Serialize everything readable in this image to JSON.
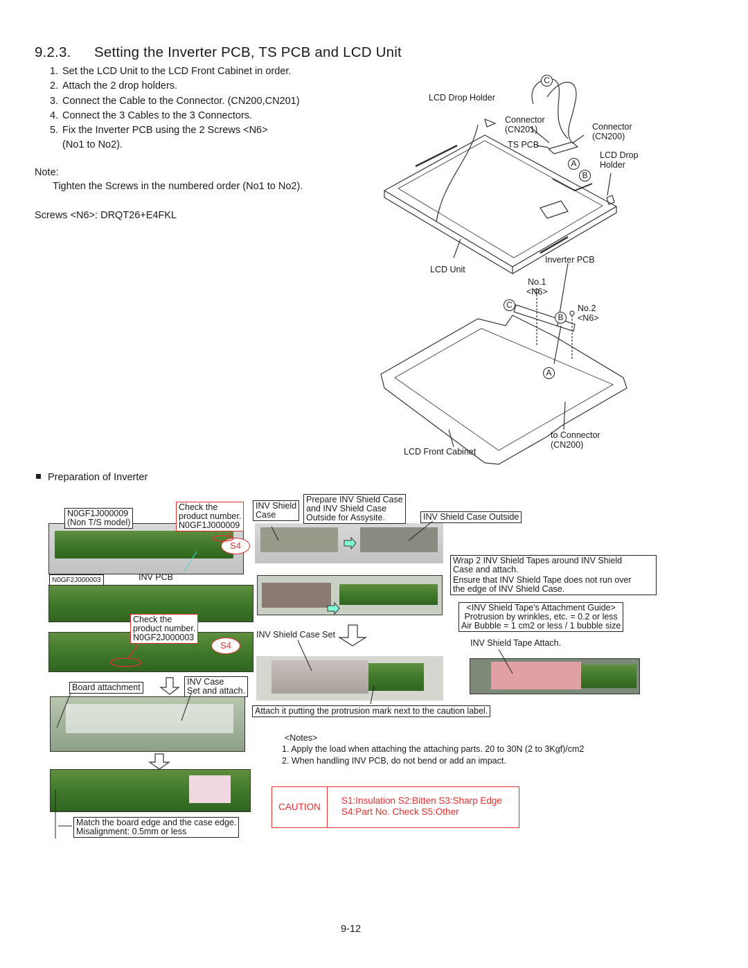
{
  "section": {
    "number": "9.2.3.",
    "title": "Setting the Inverter PCB, TS PCB and LCD Unit"
  },
  "steps": [
    {
      "num": "1.",
      "text": "Set the LCD Unit to the LCD Front Cabinet in order."
    },
    {
      "num": "2.",
      "text": "Attach the 2 drop holders."
    },
    {
      "num": "3.",
      "text": "Connect the Cable to the Connector. (CN200,CN201)"
    },
    {
      "num": "4.",
      "text": "Connect the 3 Cables to the 3 Connectors."
    },
    {
      "num": "5.",
      "text": "Fix the Inverter PCB using the 2 Screws <N6>",
      "cont": "(No1 to No2)."
    }
  ],
  "note": {
    "heading": "Note:",
    "text": "Tighten the Screws in the numbered order (No1 to No2)."
  },
  "screws": "Screws <N6>: DRQT26+E4FKL",
  "diagram_top": {
    "lcd_drop_holder_left": "LCD Drop Holder",
    "connector_cn201": [
      "Connector",
      "(CN201)"
    ],
    "connector_cn200": [
      "Connector",
      "(CN200)"
    ],
    "ts_pcb": "TS PCB",
    "lcd_drop_holder_right": [
      "LCD Drop",
      "Holder"
    ],
    "inverter_pcb": "Inverter PCB",
    "lcd_unit": "LCD Unit",
    "marker_a": "A",
    "marker_b": "B",
    "marker_c": "C"
  },
  "diagram_bottom": {
    "no1": [
      "No.1",
      "<N6>"
    ],
    "no2": [
      "No.2",
      "<N6>"
    ],
    "to_connector": [
      "to Connector",
      "(CN200)"
    ],
    "lcd_front_cabinet": "LCD Front Cabinet",
    "marker_a": "A",
    "marker_b": "B",
    "marker_c": "C"
  },
  "preparation": {
    "heading": "Preparation of Inverter",
    "n0gf1": [
      "N0GF1J000009",
      "(Non T/S model)"
    ],
    "check1": [
      "Check the",
      "product number.",
      "N0GF1J000009"
    ],
    "s4": "S4",
    "n0gf2": "N0GF2J000003",
    "inv_pcb": "INV PCB",
    "check2": [
      "Check the",
      "product number.",
      "N0GF2J000003"
    ],
    "board_attachment": "Board attachment",
    "inv_case": [
      "INV Case",
      "Set and attach."
    ],
    "match": [
      "Match the board edge and the case edge.",
      "Misalignment: 0.5mm or less"
    ],
    "inv_shield_case": [
      "INV Shield",
      "Case"
    ],
    "prepare": [
      "Prepare INV Shield Case",
      "and INV Shield Case",
      "Outside for Assysite."
    ],
    "inv_shield_case_outside": "INV Shield Case Outside",
    "wrap": [
      "Wrap 2 INV Shield Tapes around INV Shield",
      "Case and attach.",
      "Ensure that INV Shield Tape does not run over",
      "the edge of INV Shield Case."
    ],
    "guide": [
      "<INV Shield Tape's Attachment Guide>",
      "Protrusion by wrinkles, etc. = 0.2 or less",
      "Air Bubble = 1 cm2 or less / 1 bubble size"
    ],
    "tape_attach": "INV Shield Tape Attach.",
    "case_set": "INV Shield Case Set",
    "attach_mark": "Attach it putting the protrusion mark next to the caution label."
  },
  "notes": {
    "heading": "<Notes>",
    "items": [
      "1. Apply the load when attaching the attaching parts. 20 to 30N (2 to 3Kgf)/cm2",
      "2. When handling INV PCB, do not bend or add an impact."
    ]
  },
  "caution": {
    "label": "CAUTION",
    "line1": "S1:Insulation  S2:Bitten  S3:Sharp Edge",
    "line2": "S4:Part No. Check  S5:Other",
    "color": "#e03030"
  },
  "page_number": "9-12"
}
